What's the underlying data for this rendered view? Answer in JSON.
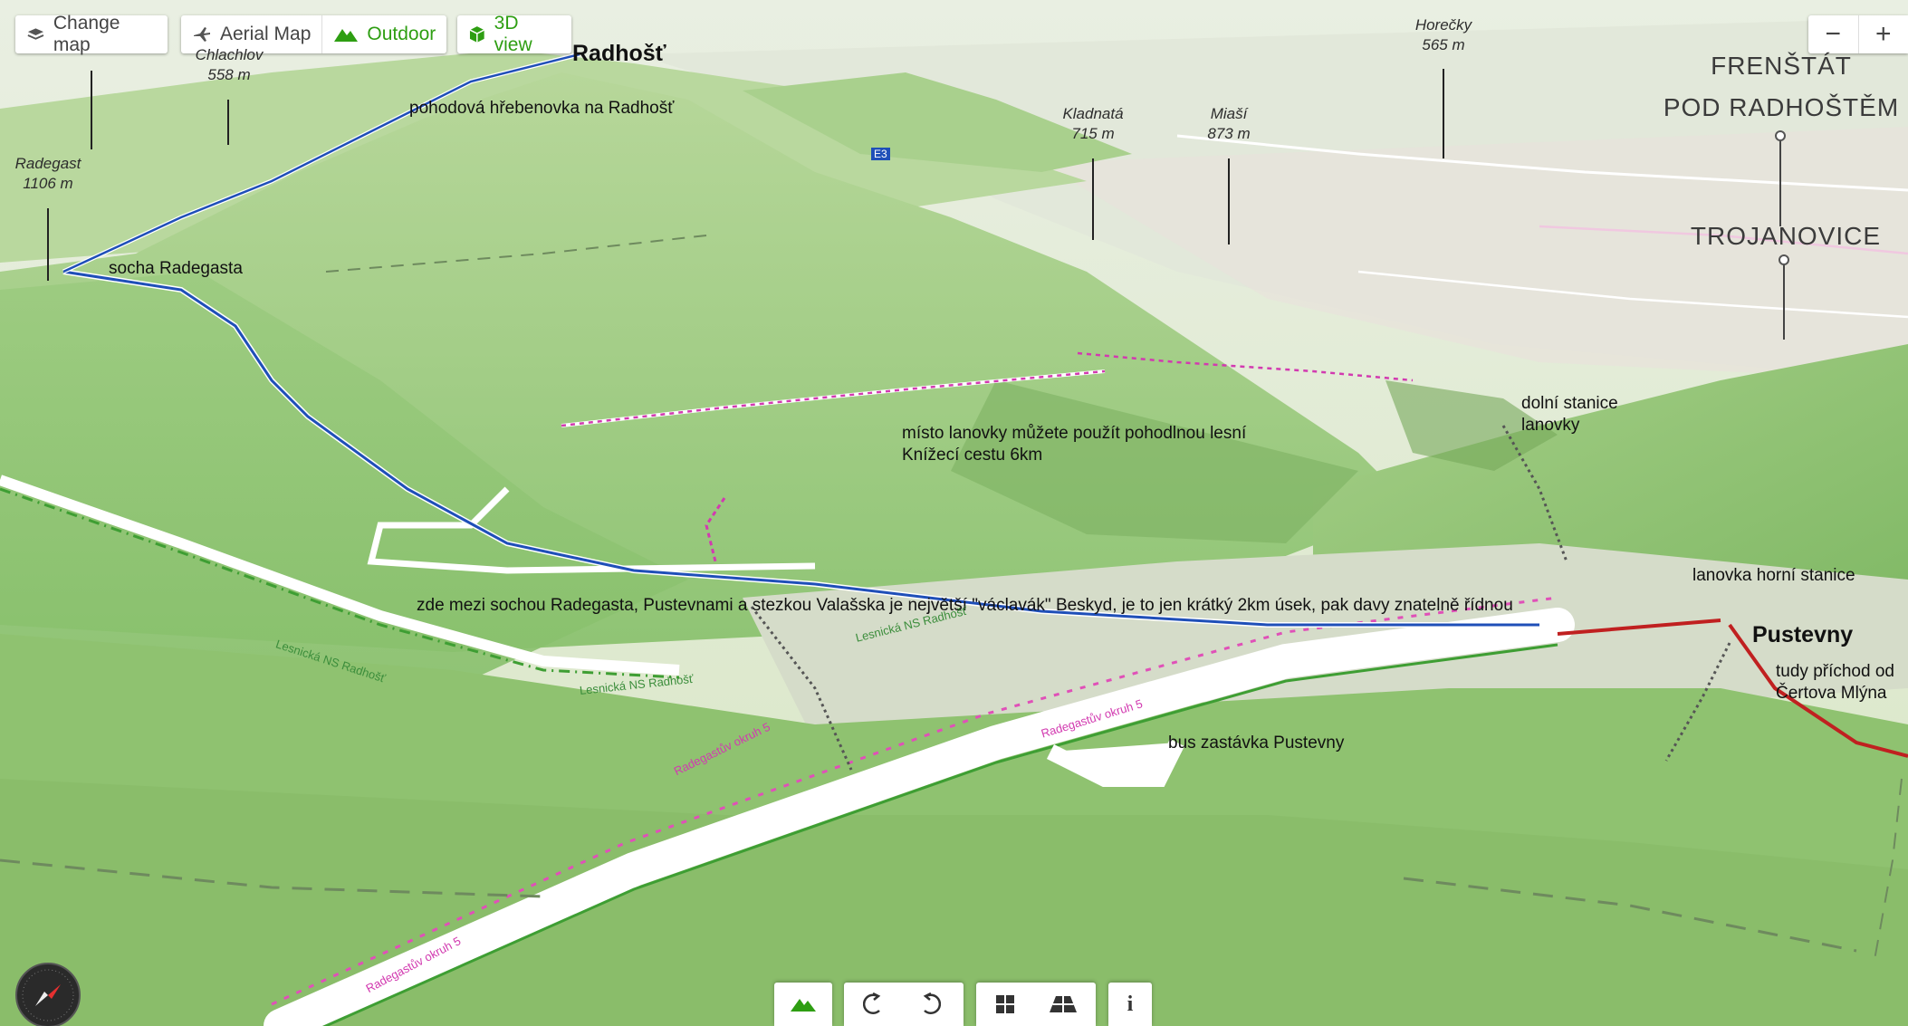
{
  "toolbar": {
    "change_map": "Change map",
    "aerial_map": "Aerial Map",
    "outdoor": "Outdoor",
    "view_3d": "3D view"
  },
  "zoom": {
    "minus": "−",
    "plus": "+"
  },
  "peaks": [
    {
      "name": "Chlachlov",
      "elevation": "558 m"
    },
    {
      "name": "Radegast",
      "elevation": "1106 m"
    },
    {
      "name": "Kladnatá",
      "elevation": "715 m"
    },
    {
      "name": "Miaší",
      "elevation": "873 m"
    },
    {
      "name": "Horečky",
      "elevation": "565 m"
    }
  ],
  "towns": {
    "frenstat_line1": "FRENŠTÁT",
    "frenstat_line2": "POD RADHOŠTĚM",
    "trojanovice": "TROJANOVICE"
  },
  "places": {
    "radhost": "Radhošť",
    "pustevny": "Pustevny"
  },
  "annotations": {
    "ridge": "pohodová hřebenovka na Radhošť",
    "statue": "socha Radegasta",
    "path_line1": "místo lanovky můžete použít pohodlnou lesní",
    "path_line2": "Knížecí cestu 6km",
    "lower_station_line1": "dolní stanice",
    "lower_station_line2": "lanovky",
    "upper_station": "lanovka horní stanice",
    "crowd": "zde mezi sochou Radegasta, Pustevnami a stezkou Valašska je největší \"václavák\" Beskyd, je to jen krátký 2km úsek, pak davy znatelně řídnou",
    "approach_line1": "tudy příchod od",
    "approach_line2": "Čertova Mlýna",
    "bus": "bus zastávka Pustevny"
  },
  "trails": {
    "radegastuv_okruh": "Radegastův okruh 5",
    "lesnicka": "Lesnická NS Radhošť",
    "e3": "E3"
  },
  "bottom": {
    "info": "i"
  },
  "colors": {
    "accent_green": "#2e9e12",
    "trail_pink": "#d23ab0"
  }
}
